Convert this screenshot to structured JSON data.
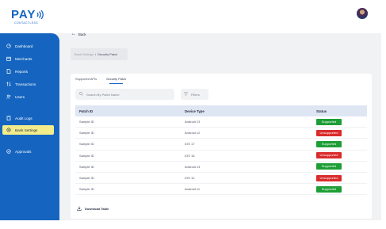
{
  "brand": {
    "name": "PAY",
    "tagline": "CONTACTLESS",
    "color": "#1565c0"
  },
  "sidebar": {
    "items": [
      {
        "label": "Dashboard",
        "icon": "dashboard-icon"
      },
      {
        "label": "Merchants",
        "icon": "store-icon"
      },
      {
        "label": "Reports",
        "icon": "file-icon"
      },
      {
        "label": "Transactions",
        "icon": "transactions-icon"
      },
      {
        "label": "Users",
        "icon": "users-icon"
      },
      {
        "label": "Audit Logs",
        "icon": "clipboard-icon"
      },
      {
        "label": "Bank Settings",
        "icon": "settings-icon",
        "active": true
      },
      {
        "label": "Approvals",
        "icon": "approval-icon"
      }
    ]
  },
  "back": {
    "label": "Back"
  },
  "breadcrumb": {
    "parent": "Bank Settings",
    "separator": "/",
    "current": "Security Patch"
  },
  "tabs": [
    {
      "label": "Supported APIs"
    },
    {
      "label": "Security Patch",
      "active": true
    }
  ],
  "search": {
    "placeholder": "Search By Patch Name"
  },
  "filter": {
    "label": "Filters"
  },
  "table": {
    "columns": [
      "Patch ID",
      "Device Type",
      "Status"
    ],
    "rows": [
      {
        "patch_id": "Sample ID",
        "device": "Android 13",
        "status": "Supported"
      },
      {
        "patch_id": "Sample ID",
        "device": "Android 12",
        "status": "Unsupported"
      },
      {
        "patch_id": "Sample ID",
        "device": "IOS 17",
        "status": "Supported"
      },
      {
        "patch_id": "Sample ID",
        "device": "IOS 15",
        "status": "Unsupported"
      },
      {
        "patch_id": "Sample ID",
        "device": "Android 13",
        "status": "Supported"
      },
      {
        "patch_id": "Sample ID",
        "device": "IOS 12",
        "status": "Unsupported"
      },
      {
        "patch_id": "Sample ID",
        "device": "Android 11",
        "status": "Supported"
      }
    ]
  },
  "download": {
    "label": "Download Table"
  },
  "colors": {
    "supported": "#1e9e36",
    "unsupported": "#d92b2b",
    "accent": "#1565c0",
    "active_nav": "#f3ec8b"
  }
}
